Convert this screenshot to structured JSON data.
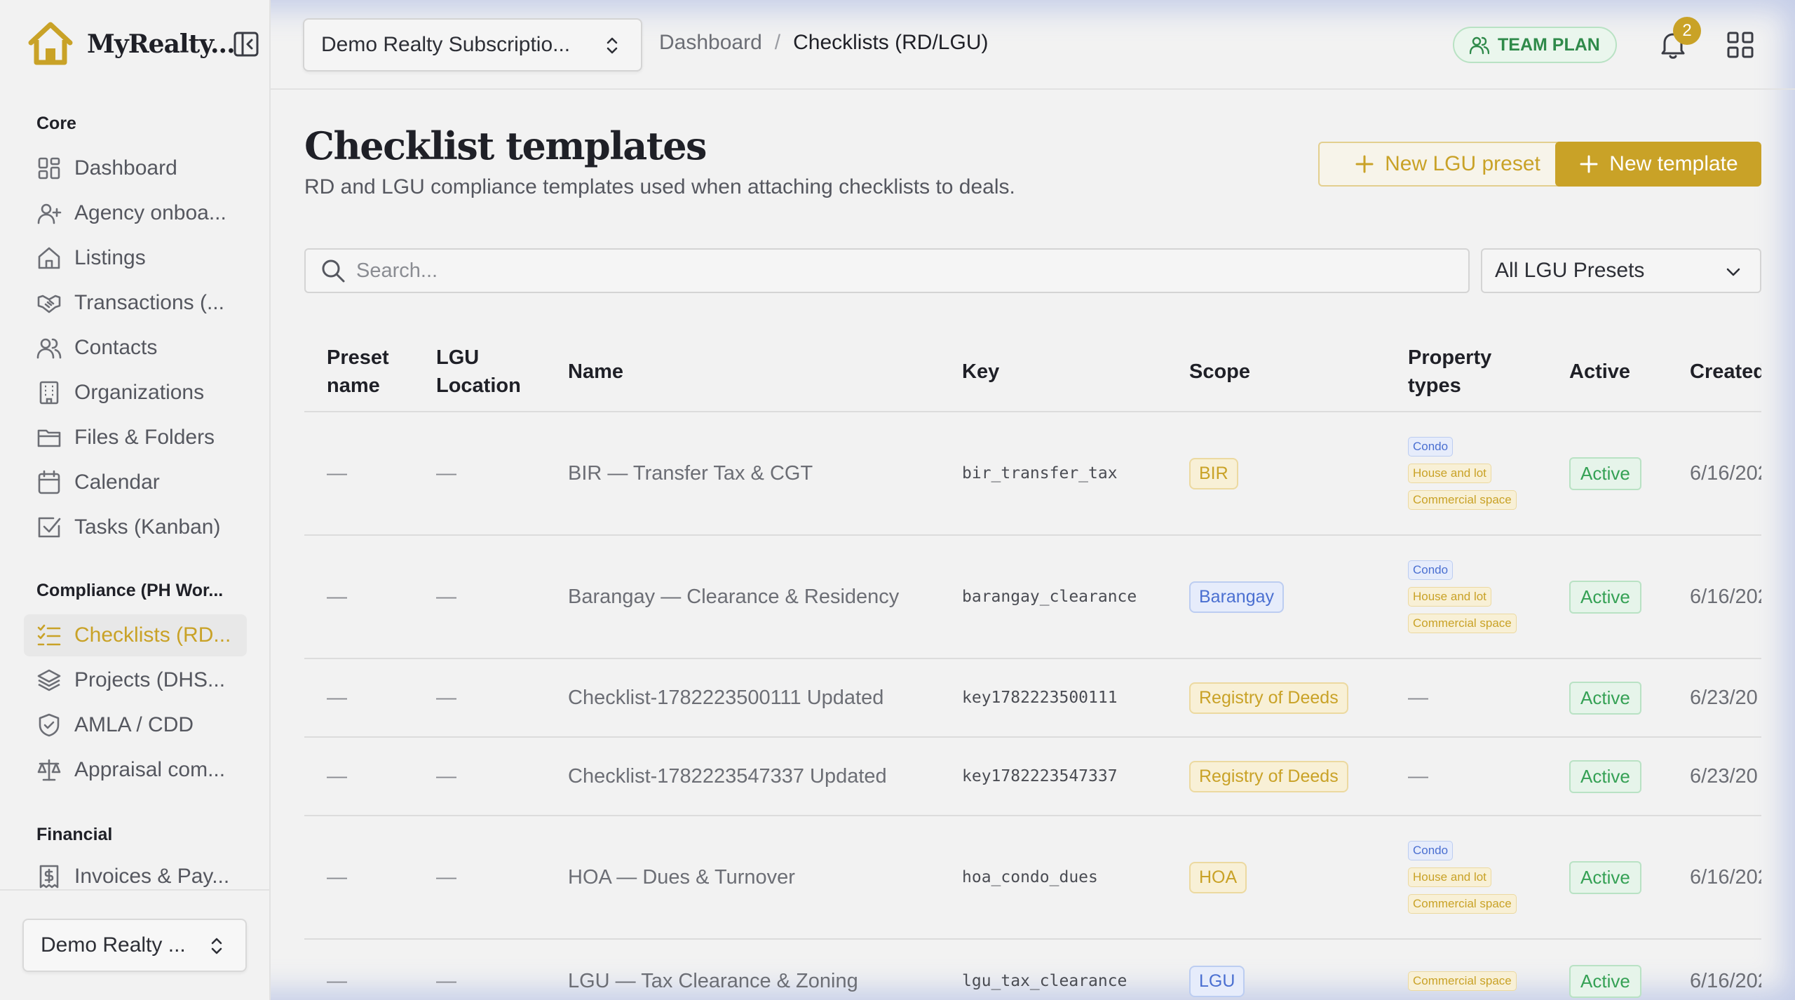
{
  "app": {
    "brand_name": "MyRealty...",
    "subscription_label": "Demo Realty Subscriptio...",
    "org_label": "Demo Realty ...",
    "plan_badge": "TEAM PLAN",
    "notification_count": "2"
  },
  "breadcrumb": {
    "root": "Dashboard",
    "separator": "/",
    "current": "Checklists (RD/LGU)"
  },
  "sidebar": {
    "sections": [
      {
        "title": "Core",
        "items": [
          {
            "label": "Dashboard",
            "icon": "dashboard-icon"
          },
          {
            "label": "Agency onboa...",
            "icon": "user-plus-icon"
          },
          {
            "label": "Listings",
            "icon": "home-icon"
          },
          {
            "label": "Transactions (...",
            "icon": "handshake-icon"
          },
          {
            "label": "Contacts",
            "icon": "users-icon"
          },
          {
            "label": "Organizations",
            "icon": "building-icon"
          },
          {
            "label": "Files & Folders",
            "icon": "folder-icon"
          },
          {
            "label": "Calendar",
            "icon": "calendar-icon"
          },
          {
            "label": "Tasks (Kanban)",
            "icon": "check-square-icon"
          }
        ]
      },
      {
        "title": "Compliance (PH Wor...",
        "items": [
          {
            "label": "Checklists (RD...",
            "icon": "list-checks-icon",
            "active": true
          },
          {
            "label": "Projects (DHS...",
            "icon": "layers-icon"
          },
          {
            "label": "AMLA / CDD",
            "icon": "shield-check-icon"
          },
          {
            "label": "Appraisal com...",
            "icon": "scale-icon"
          }
        ]
      },
      {
        "title": "Financial",
        "items": [
          {
            "label": "Invoices & Pay...",
            "icon": "receipt-dollar-icon"
          }
        ]
      }
    ]
  },
  "page": {
    "title": "Checklist templates",
    "subtitle": "RD and LGU compliance templates used when attaching checklists to deals.",
    "new_preset_label": "New LGU preset",
    "new_template_label": "New template",
    "search_placeholder": "Search...",
    "preset_filter": "All LGU Presets"
  },
  "table": {
    "headers": {
      "preset_name": "Preset name",
      "lgu_location": "LGU Location",
      "name": "Name",
      "key": "Key",
      "scope": "Scope",
      "property_types": "Property types",
      "active": "Active",
      "created": "Created"
    },
    "rows": [
      {
        "preset": "—",
        "lgu": "—",
        "name": "BIR — Transfer Tax & CGT",
        "key": "bir_transfer_tax",
        "scope": "BIR",
        "scope_color": "gold",
        "property_types": [
          "Condo",
          "House and lot",
          "Commercial space"
        ],
        "active": "Active",
        "created": "6/16/202"
      },
      {
        "preset": "—",
        "lgu": "—",
        "name": "Barangay — Clearance & Residency",
        "key": "barangay_clearance",
        "scope": "Barangay",
        "scope_color": "blue",
        "property_types": [
          "Condo",
          "House and lot",
          "Commercial space"
        ],
        "active": "Active",
        "created": "6/16/202"
      },
      {
        "preset": "—",
        "lgu": "—",
        "name": "Checklist-1782223500111 Updated",
        "key": "key1782223500111",
        "scope": "Registry of Deeds",
        "scope_color": "gold",
        "property_types": [],
        "property_types_empty": "—",
        "active": "Active",
        "created": "6/23/20"
      },
      {
        "preset": "—",
        "lgu": "—",
        "name": "Checklist-1782223547337 Updated",
        "key": "key1782223547337",
        "scope": "Registry of Deeds",
        "scope_color": "gold",
        "property_types": [],
        "property_types_empty": "—",
        "active": "Active",
        "created": "6/23/20"
      },
      {
        "preset": "—",
        "lgu": "—",
        "name": "HOA — Dues & Turnover",
        "key": "hoa_condo_dues",
        "scope": "HOA",
        "scope_color": "gold",
        "property_types": [
          "Condo",
          "House and lot",
          "Commercial space"
        ],
        "active": "Active",
        "created": "6/16/202"
      },
      {
        "preset": "—",
        "lgu": "—",
        "name": "LGU — Tax Clearance & Zoning",
        "key": "lgu_tax_clearance",
        "scope": "LGU",
        "scope_color": "blue",
        "property_types": [
          "Commercial space"
        ],
        "active": "Active",
        "created": "6/16/202"
      }
    ]
  },
  "colors": {
    "accent": "#c9a227",
    "active_green": "#35a155",
    "scope_blue": "#4a6fd1"
  }
}
